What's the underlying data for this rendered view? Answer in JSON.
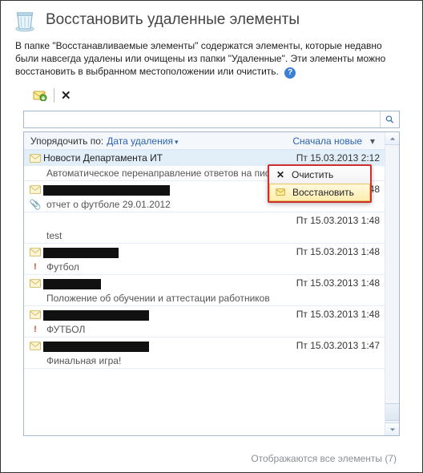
{
  "header": {
    "title": "Восстановить удаленные элементы"
  },
  "description": {
    "text": "В папке \"Восстанавливаемые элементы\" содержатся элементы, которые недавно были навсегда удалены или очищены из папки \"Удаленные\". Эти элементы можно восстановить в выбранном местоположении или очистить."
  },
  "sort_bar": {
    "arrange_by": "Упорядочить по:",
    "field": "Дата удаления",
    "order": "Сначала новые"
  },
  "context_menu": {
    "clear": "Очистить",
    "restore": "Восстановить"
  },
  "items": [
    {
      "from": "Новости Департамента ИТ",
      "date": "Пт 15.03.2013 2:12",
      "subject": "Автоматическое перенаправление ответов на письмо п",
      "highlight": true,
      "from_redacted": false,
      "icon": "envelope",
      "extra": ""
    },
    {
      "from": "",
      "date": "48",
      "subject": "отчет о футболе 29.01.2012",
      "highlight": false,
      "from_redacted": true,
      "redact_w": 158,
      "icon": "envelope",
      "extra": "attach"
    },
    {
      "from": "",
      "date": "Пт 15.03.2013 1:48",
      "subject": "test",
      "highlight": false,
      "from_redacted": true,
      "redact_w": 0,
      "icon": "",
      "extra": ""
    },
    {
      "from": "",
      "date": "Пт 15.03.2013 1:48",
      "subject": "Футбол",
      "highlight": false,
      "from_redacted": true,
      "redact_w": 94,
      "icon": "envelope",
      "extra": "flag"
    },
    {
      "from": "",
      "date": "Пт 15.03.2013 1:48",
      "subject": "Положение об обучении и аттестации работников",
      "highlight": false,
      "from_redacted": true,
      "redact_w": 72,
      "icon": "envelope",
      "extra": ""
    },
    {
      "from": "",
      "date": "Пт 15.03.2013 1:48",
      "subject": "ФУТБОЛ",
      "highlight": false,
      "from_redacted": true,
      "redact_w": 132,
      "icon": "envelope",
      "extra": "flag"
    },
    {
      "from": "",
      "date": "Пт 15.03.2013 1:47",
      "subject": "Финальная игра!",
      "highlight": false,
      "from_redacted": true,
      "redact_w": 132,
      "icon": "envelope",
      "extra": ""
    }
  ],
  "footer": {
    "status": "Отображаются все элементы (7)"
  }
}
